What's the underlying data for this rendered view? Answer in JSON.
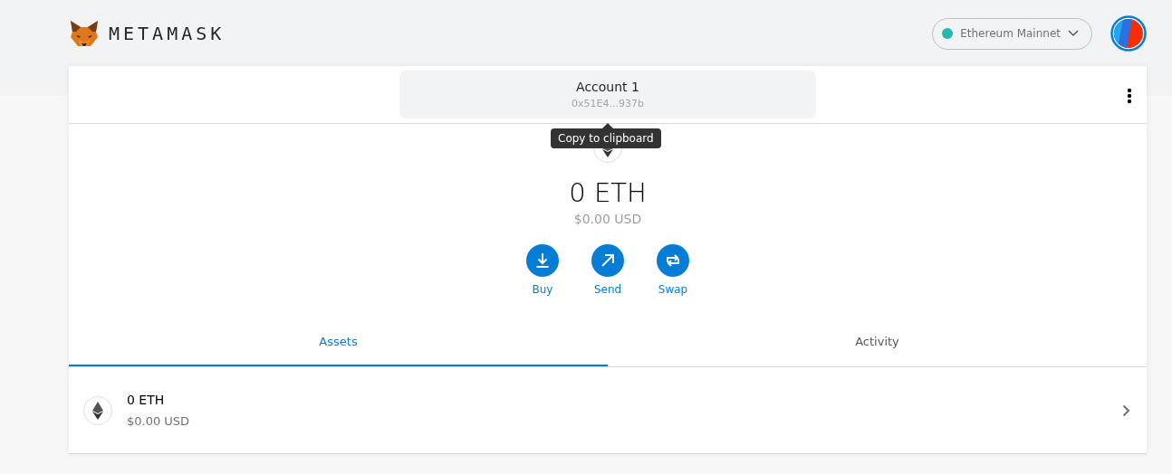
{
  "app": {
    "logo_text": "METAMASK"
  },
  "network": {
    "name": "Ethereum Mainnet",
    "color": "#29b6af"
  },
  "account": {
    "name": "Account 1",
    "address": "0x51E4...937b",
    "tooltip": "Copy to clipboard"
  },
  "balance": {
    "amount": "0 ETH",
    "fiat": "$0.00 USD"
  },
  "actions": [
    {
      "kind": "buy",
      "label": "Buy"
    },
    {
      "kind": "send",
      "label": "Send"
    },
    {
      "kind": "swap",
      "label": "Swap"
    }
  ],
  "tabs": [
    {
      "label": "Assets",
      "selected": true
    },
    {
      "label": "Activity",
      "selected": false
    }
  ],
  "assets": [
    {
      "amount": "0 ETH",
      "fiat": "$0.00 USD"
    }
  ]
}
